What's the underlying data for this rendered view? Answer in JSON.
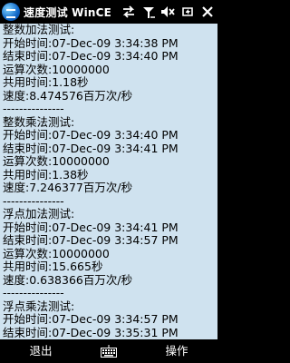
{
  "status_bar": {
    "title": "速度测试 WinCE",
    "icons": [
      "start-logo-icon",
      "connectivity-icon",
      "signal-icon",
      "volume-muted-icon",
      "power-icon",
      "close-icon"
    ]
  },
  "log": [
    "整数加法测试:",
    "开始时间:07-Dec-09 3:34:38 PM",
    "结束时间:07-Dec-09 3:34:40 PM",
    "运算次数:10000000",
    "共用时间:1.18秒",
    "速度:8.474576百万次/秒",
    "---------------",
    "整数乘法测试:",
    "开始时间:07-Dec-09 3:34:40 PM",
    "结束时间:07-Dec-09 3:34:41 PM",
    "运算次数:10000000",
    "共用时间:1.38秒",
    "速度:7.246377百万次/秒",
    "---------------",
    "浮点加法测试:",
    "开始时间:07-Dec-09 3:34:41 PM",
    "结束时间:07-Dec-09 3:34:57 PM",
    "运算次数:10000000",
    "共用时间:15.665秒",
    "速度:0.638366百万次/秒",
    "---------------",
    "浮点乘法测试:",
    "开始时间:07-Dec-09 3:34:57 PM",
    "结束时间:07-Dec-09 3:35:31 PM"
  ],
  "softkeys": {
    "left": "退出",
    "right": "操作",
    "center_icon": "keyboard-icon"
  },
  "colors": {
    "content_background": "#cfe2ef",
    "bar_background": "#000000",
    "bar_text": "#ffffff"
  }
}
